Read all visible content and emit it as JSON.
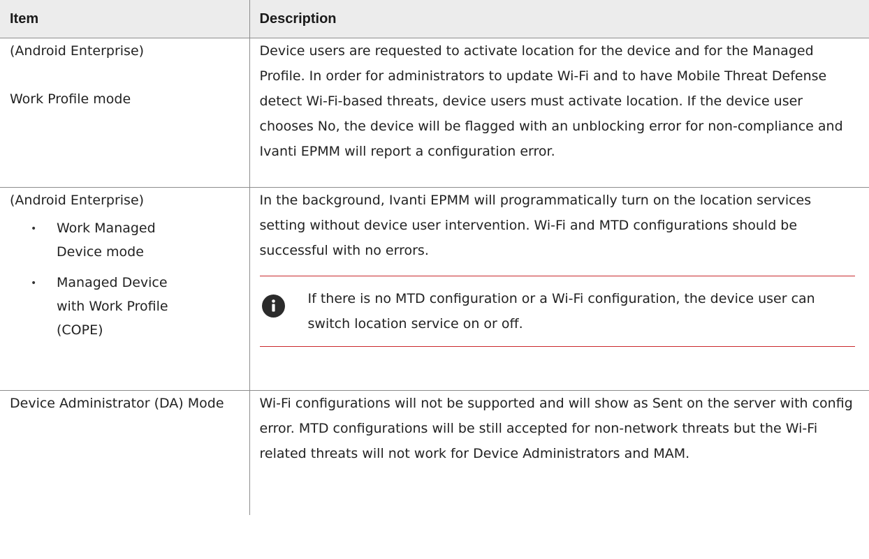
{
  "table": {
    "headers": {
      "item": "Item",
      "description": "Description"
    },
    "rows": [
      {
        "item_lines": [
          "(Android Enterprise)",
          "Work Profile mode"
        ],
        "description": "Device users are requested to activate location for the device and for the Managed Profile. In order for administrators to update Wi-Fi and to have Mobile Threat Defense detect Wi-Fi-based threats, device users must activate location. If the device user chooses No, the device will be flagged with an unblocking error for non-compliance and Ivanti EPMM will report a configuration error."
      },
      {
        "item_title": "(Android Enterprise)",
        "item_bullets": [
          "Work Managed Device mode",
          "Managed Device with Work Profile (COPE)"
        ],
        "description": "In the background, Ivanti EPMM will programmatically turn on the location services setting without device user intervention. Wi-Fi and MTD configurations should be successful with no errors.",
        "note": {
          "icon": "info-icon",
          "text": "If there is no MTD configuration or a Wi-Fi configuration, the device user can switch location service on or off.",
          "accent_color": "#c9292d"
        }
      },
      {
        "item_lines": [
          "Device Administrator (DA) Mode"
        ],
        "description": "Wi-Fi configurations will not be supported and will show as Sent on the server with config error. MTD configurations will be still accepted for non-network threats but the Wi-Fi related threats will not work for Device Administrators and MAM."
      }
    ]
  }
}
